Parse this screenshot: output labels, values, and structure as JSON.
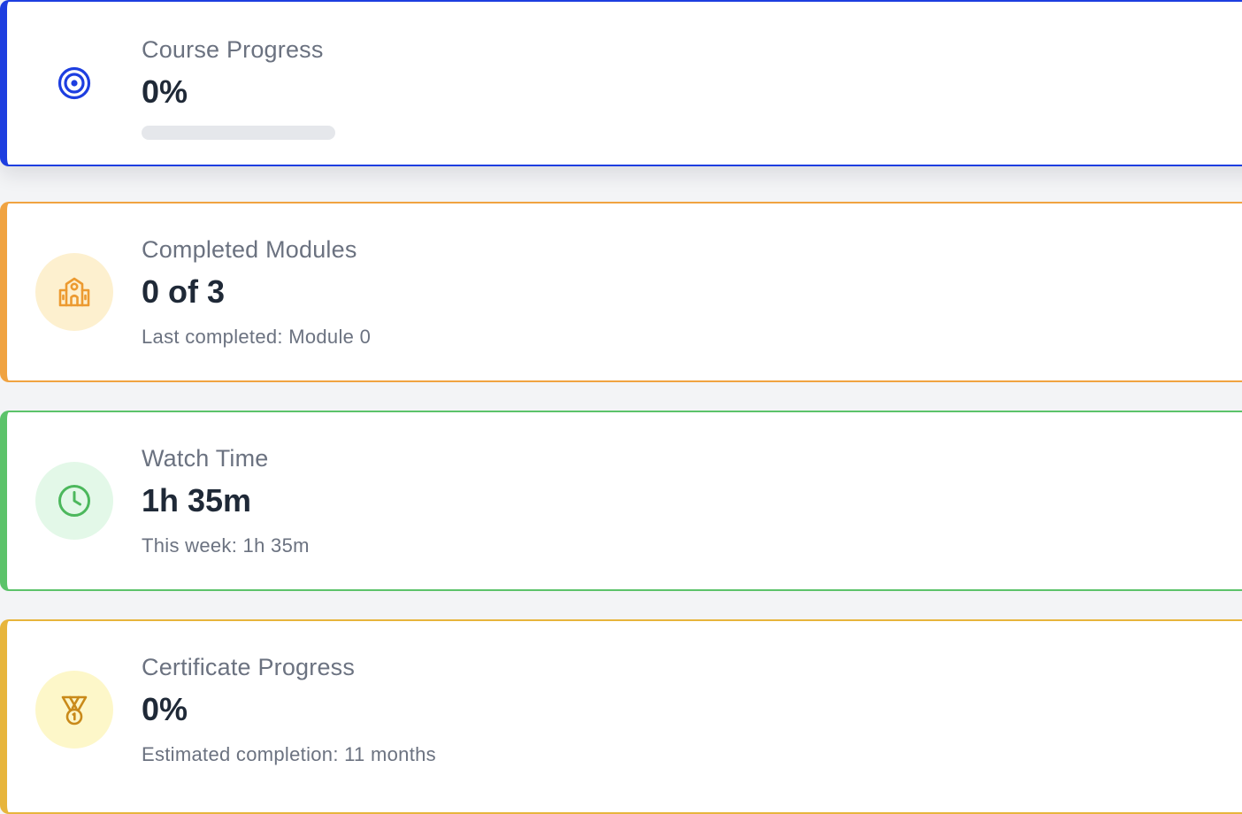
{
  "colors": {
    "progress_accent": "#1d3ee0",
    "modules_accent": "#f0a341",
    "watch_accent": "#5cc36a",
    "certificate_accent": "#e7b53c"
  },
  "course_progress": {
    "icon": "target-icon",
    "label": "Course Progress",
    "value": "0%",
    "progress_fraction": 0
  },
  "completed_modules": {
    "icon": "school-building-icon",
    "label": "Completed Modules",
    "value": "0 of 3",
    "sub": "Last completed: Module 0"
  },
  "watch_time": {
    "icon": "clock-icon",
    "label": "Watch Time",
    "value": "1h 35m",
    "sub": "This week: 1h 35m"
  },
  "certificate_progress": {
    "icon": "medal-icon",
    "label": "Certificate Progress",
    "value": "0%",
    "sub": "Estimated completion: 11 months"
  }
}
